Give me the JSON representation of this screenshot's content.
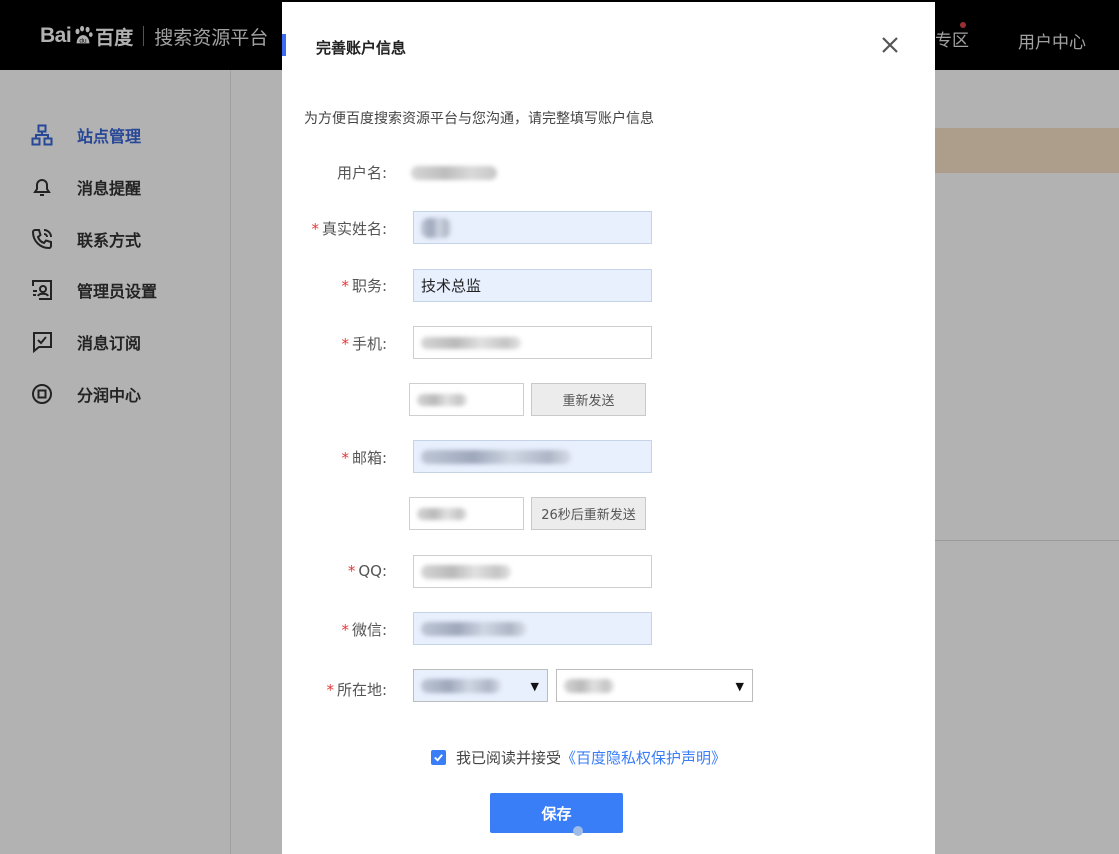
{
  "header": {
    "logo_bai": "Bai",
    "logo_baidu": "百度",
    "platform": "搜索资源平台",
    "zone_partial": "专区",
    "user_center": "用户中心"
  },
  "sidebar": {
    "items": [
      {
        "label": "站点管理",
        "icon": "sitemap-icon",
        "active": true
      },
      {
        "label": "消息提醒",
        "icon": "bell-icon",
        "active": false
      },
      {
        "label": "联系方式",
        "icon": "phone-icon",
        "active": false
      },
      {
        "label": "管理员设置",
        "icon": "admin-icon",
        "active": false
      },
      {
        "label": "消息订阅",
        "icon": "subscribe-icon",
        "active": false
      },
      {
        "label": "分润中心",
        "icon": "revenue-icon",
        "active": false
      }
    ]
  },
  "modal": {
    "title": "完善账户信息",
    "description": "为方便百度搜索资源平台与您沟通，请完整填写账户信息",
    "fields": {
      "username": {
        "label": "用户名:"
      },
      "real_name": {
        "label": "真实姓名:",
        "required": "*"
      },
      "position": {
        "label": "职务:",
        "required": "*",
        "value": "技术总监"
      },
      "phone": {
        "label": "手机:",
        "required": "*"
      },
      "phone_code_button": "重新发送",
      "email": {
        "label": "邮箱:",
        "required": "*"
      },
      "email_code_button": "26秒后重新发送",
      "qq": {
        "label": "QQ:",
        "required": "*"
      },
      "wechat": {
        "label": "微信:",
        "required": "*"
      },
      "location": {
        "label": "所在地:",
        "required": "*",
        "caret": "▼"
      }
    },
    "agreement": {
      "text": "我已阅读并接受",
      "link": "《百度隐私权保护声明》",
      "checked": true
    },
    "save_label": "保存"
  },
  "colors": {
    "accent": "#3a7ef7",
    "sidebar_active": "#3866d9",
    "required": "#e53935",
    "input_filled_bg": "#e8effd"
  }
}
